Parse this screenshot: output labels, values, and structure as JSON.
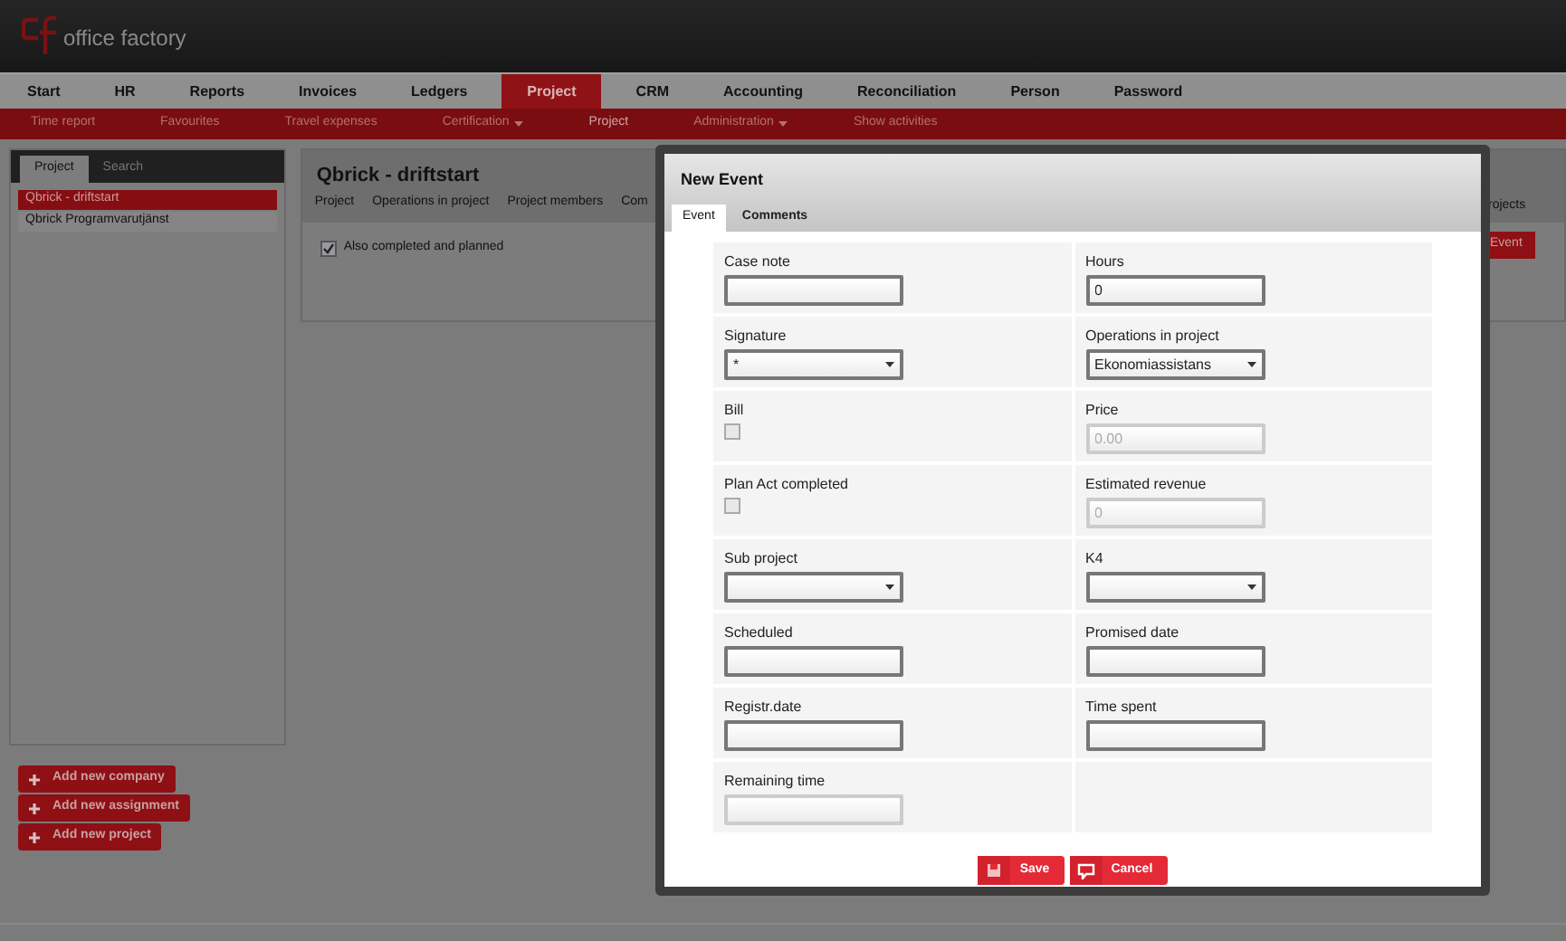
{
  "app": {
    "logo_text": "office factory"
  },
  "main_nav": [
    {
      "label": "Start",
      "selected": false
    },
    {
      "label": "HR",
      "selected": false
    },
    {
      "label": "Reports",
      "selected": false
    },
    {
      "label": "Invoices",
      "selected": false
    },
    {
      "label": "Ledgers",
      "selected": false
    },
    {
      "label": "Project",
      "selected": true
    },
    {
      "label": "CRM",
      "selected": false
    },
    {
      "label": "Accounting",
      "selected": false
    },
    {
      "label": "Reconciliation",
      "selected": false
    },
    {
      "label": "Person",
      "selected": false
    },
    {
      "label": "Password",
      "selected": false
    }
  ],
  "sub_nav": [
    {
      "label": "Time report",
      "has_menu": false,
      "selected": false
    },
    {
      "label": "Favourites",
      "has_menu": false,
      "selected": false
    },
    {
      "label": "Travel expenses",
      "has_menu": false,
      "selected": false
    },
    {
      "label": "Certification",
      "has_menu": true,
      "selected": false
    },
    {
      "label": "Project",
      "has_menu": false,
      "selected": true
    },
    {
      "label": "Administration",
      "has_menu": true,
      "selected": false
    },
    {
      "label": "Show activities",
      "has_menu": false,
      "selected": false
    }
  ],
  "sidebar": {
    "tabs": [
      {
        "label": "Project",
        "selected": true
      },
      {
        "label": "Search",
        "selected": false
      }
    ],
    "items": [
      {
        "label": "Qbrick - driftstart",
        "selected": true
      },
      {
        "label": "Qbrick Programvarutjänst",
        "selected": false
      }
    ],
    "buttons": [
      "Add new company",
      "Add new assignment",
      "Add new project"
    ]
  },
  "project": {
    "title": "Qbrick - driftstart",
    "tabs": [
      "Project",
      "Operations in project",
      "Project members",
      "Com"
    ],
    "right_tab": "rojects",
    "right_button": "Event",
    "filter": {
      "label": "Also completed and planned",
      "checked": true
    }
  },
  "dialog": {
    "title": "New Event",
    "tabs": [
      {
        "label": "Event",
        "selected": true
      },
      {
        "label": "Comments",
        "selected": false
      }
    ],
    "fields": [
      {
        "kind": "text",
        "label": "Case note",
        "disabled": false
      },
      {
        "kind": "text",
        "label": "Hours",
        "value": "0",
        "disabled": false
      },
      {
        "kind": "select",
        "label": "Signature",
        "value": "*"
      },
      {
        "kind": "select",
        "label": "Operations in project",
        "value": "Ekonomiassistans"
      },
      {
        "kind": "checkbox",
        "label": "Bill",
        "checked": false
      },
      {
        "kind": "text",
        "label": "Price",
        "value": "0.00",
        "disabled": true
      },
      {
        "kind": "checkbox",
        "label": "Plan Act completed",
        "checked": false
      },
      {
        "kind": "text",
        "label": "Estimated revenue",
        "value": "0",
        "disabled": true
      },
      {
        "kind": "select",
        "label": "Sub project"
      },
      {
        "kind": "select",
        "label": "K4"
      },
      {
        "kind": "text",
        "label": "Scheduled",
        "disabled": false
      },
      {
        "kind": "text",
        "label": "Promised date",
        "disabled": false
      },
      {
        "kind": "text",
        "label": "Registr.date",
        "disabled": false
      },
      {
        "kind": "text",
        "label": "Time spent",
        "disabled": false
      },
      {
        "kind": "text",
        "label": "Remaining time",
        "disabled": true
      }
    ],
    "buttons": [
      {
        "kind": "save",
        "label": "Save"
      },
      {
        "kind": "cancel",
        "label": "Cancel"
      }
    ]
  }
}
